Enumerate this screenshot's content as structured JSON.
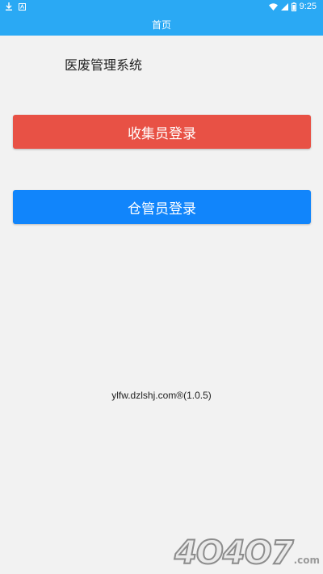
{
  "status_bar": {
    "left_icons": [
      "download-icon",
      "app-notification-icon"
    ],
    "right_icons": [
      "wifi-icon",
      "signal-icon",
      "battery-icon"
    ],
    "time": "9:25"
  },
  "app_bar": {
    "title": "首页",
    "color": "#2aa9f4"
  },
  "main": {
    "heading": "医废管理系统",
    "collector_login_label": "收集员登录",
    "collector_color": "#e85145",
    "warehouse_login_label": "仓管员登录",
    "warehouse_color": "#1185fb",
    "footer": "ylfw.dzlshj.com®(1.0.5)"
  },
  "watermark": {
    "main": "4O4O7",
    "suffix": ".com"
  }
}
